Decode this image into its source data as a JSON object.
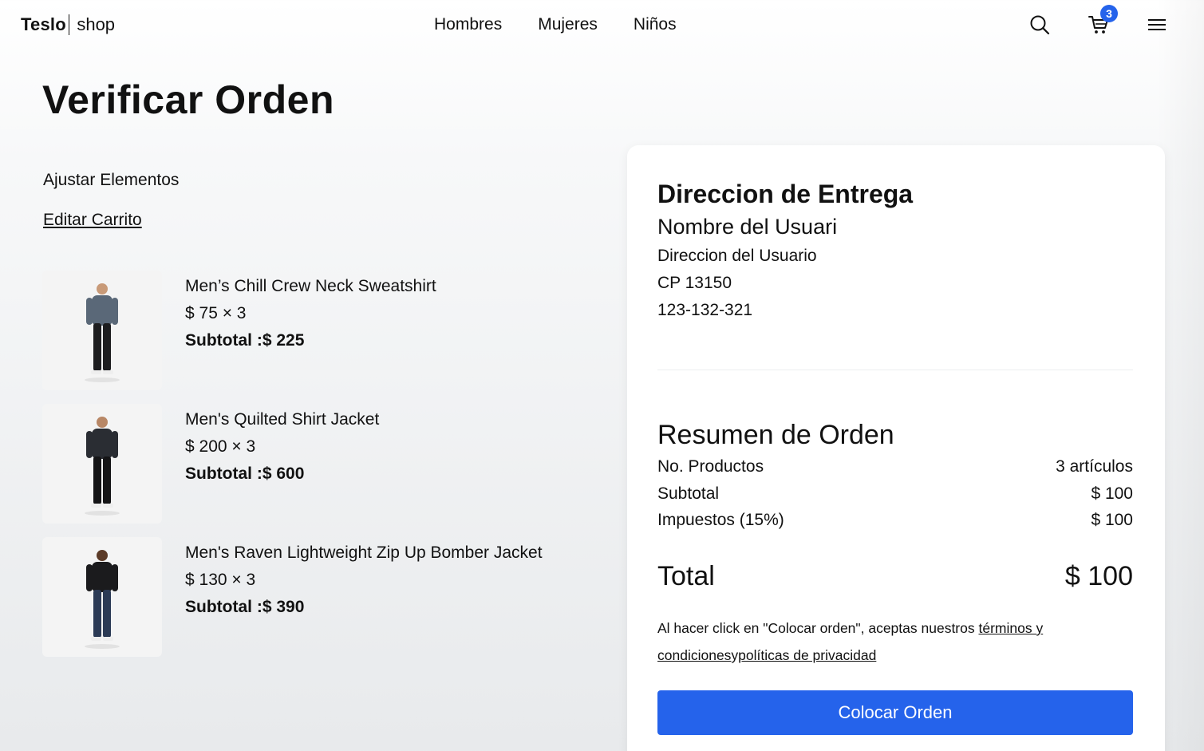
{
  "nav": {
    "logo_bold": "Teslo",
    "logo_light": "shop",
    "links": [
      "Hombres",
      "Mujeres",
      "Niños"
    ],
    "cart_count": "3"
  },
  "page": {
    "title": "Verificar Orden",
    "adjust_label": "Ajustar Elementos",
    "edit_cart_link": "Editar Carrito"
  },
  "products": [
    {
      "name": "Men’s Chill Crew Neck Sweatshirt",
      "price_qty": "$ 75 × 3",
      "subtotal": "Subtotal :$ 225",
      "shirt_color": "#5a6878",
      "pants_color": "#1d1d1f"
    },
    {
      "name": "Men's Quilted Shirt Jacket",
      "price_qty": "$ 200 × 3",
      "subtotal": "Subtotal :$ 600",
      "shirt_color": "#2a2d33",
      "pants_color": "#141416"
    },
    {
      "name": "Men's Raven Lightweight Zip Up Bomber Jacket",
      "price_qty": "$ 130 × 3",
      "subtotal": "Subtotal :$ 390",
      "shirt_color": "#1b1b1d",
      "pants_color": "#2b3a55"
    }
  ],
  "address": {
    "title": "Direccion de Entrega",
    "name": "Nombre del Usuari",
    "line1": "Direccion del Usuario",
    "zip": "CP 13150",
    "phone": "123-132-321"
  },
  "summary": {
    "title": "Resumen de Orden",
    "products_label": "No. Productos",
    "products_value": "3 artículos",
    "subtotal_label": "Subtotal",
    "subtotal_value": "$ 100",
    "tax_label": "Impuestos (15%)",
    "tax_value": "$ 100",
    "total_label": "Total",
    "total_value": "$ 100"
  },
  "legal": {
    "prefix": "Al hacer click en \"Colocar orden\", aceptas nuestros ",
    "terms": "términos y condiciones",
    "joiner": "y",
    "privacy": "políticas de privacidad"
  },
  "button": {
    "place_order": "Colocar Orden"
  },
  "colors": {
    "accent": "#2563eb"
  }
}
